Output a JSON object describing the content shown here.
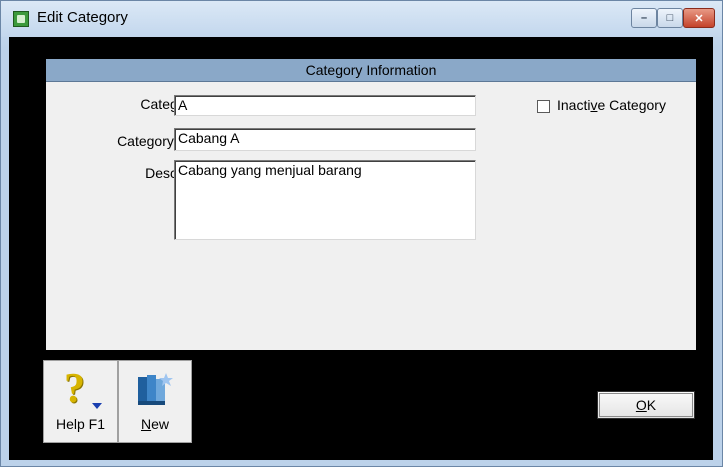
{
  "window": {
    "title": "Edit Category",
    "controls": {
      "minimize": "–",
      "maximize": "□",
      "close": "✕"
    }
  },
  "section": {
    "header": "Category Information"
  },
  "form": {
    "category_id": {
      "label": "Category ID:",
      "value": "A"
    },
    "category_name": {
      "label": "Category Name:",
      "value": "Cabang A"
    },
    "description": {
      "label": "Description:",
      "value": "Cabang yang menjual barang"
    },
    "inactive": {
      "label_pre": "Inacti",
      "label_key": "v",
      "label_post": "e Category",
      "checked": false
    }
  },
  "toolbar": {
    "help": {
      "label": "Help F1",
      "icon": "help-icon"
    },
    "new": {
      "label_key": "N",
      "label_rest": "ew",
      "icon": "new-icon"
    }
  },
  "ok": {
    "label_key": "O",
    "label_rest": "K"
  },
  "colors": {
    "header_bg": "#8aa8c8",
    "frame_bg": "#000000",
    "panel_bg": "#f0f0f0"
  }
}
